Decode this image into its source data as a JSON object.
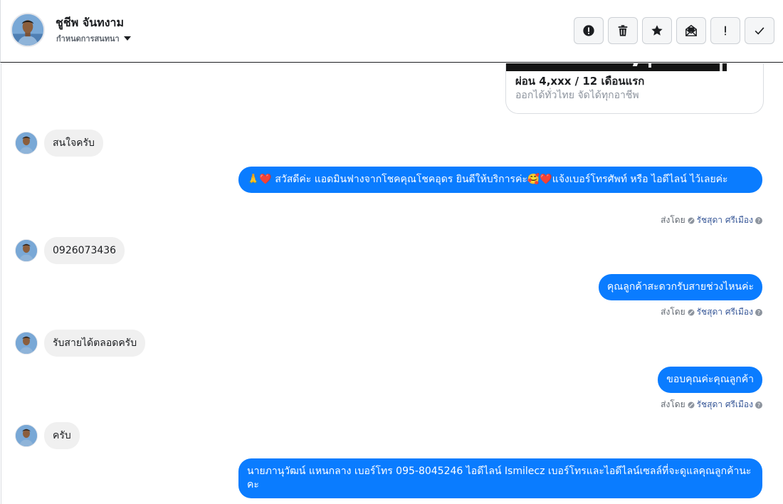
{
  "header": {
    "contact_name": "ชูชีพ จันทงาม",
    "assign_label": "กำหนดการสนทนา",
    "toolbar": [
      {
        "name": "mark-spam-button",
        "icon": "alert-circle-icon"
      },
      {
        "name": "delete-button",
        "icon": "trash-icon"
      },
      {
        "name": "star-button",
        "icon": "star-icon"
      },
      {
        "name": "mark-unread-button",
        "icon": "envelope-open-icon"
      },
      {
        "name": "follow-up-button",
        "icon": "exclamation-icon"
      },
      {
        "name": "mark-done-button",
        "icon": "check-icon"
      }
    ]
  },
  "card": {
    "title": "ผ่อน 4,xxx / 12 เดือนแรก",
    "subtitle": "ออกได้ทั่วไทย จัดได้ทุกอาชีพ"
  },
  "messages": [
    {
      "dir": "in",
      "text": "สนใจครับ"
    },
    {
      "dir": "out",
      "text": "🙏❤️ สวัสดีค่ะ แอดมินฟางจากโชคคุณโชคอุดร ยินดีให้บริการค่ะ🥰❤️แจ้งเบอร์โทรศัพท์ หรือ ไอดีไลน์  ไว้เลยค่ะ"
    },
    {
      "dir": "in",
      "text": "0926073436"
    },
    {
      "dir": "out",
      "text": "คุณลูกค้าสะดวกรับสายช่วงไหนค่ะ"
    },
    {
      "dir": "in",
      "text": "รับสายได้ตลอดครับ"
    },
    {
      "dir": "out",
      "text": "ขอบคุณค่ะคุณลูกค้า"
    },
    {
      "dir": "in",
      "text": "ครับ"
    },
    {
      "dir": "out",
      "text": "นายภานุวัฒน์ แหนกลาง เบอร์โทร 095-8045246 ไอดีไลน์ Ismilecz   เบอร์โทรและไอดีไลน์เซลล์ที่จะดูแลคุณลูกค้านะคะ"
    }
  ],
  "sent_by": {
    "prefix": "ส่งโดย",
    "agent": "รัชสุดา ศรีเมือง"
  },
  "colors": {
    "outgoing_bubble": "#0a7cff",
    "incoming_bubble": "#f0f0f0"
  }
}
